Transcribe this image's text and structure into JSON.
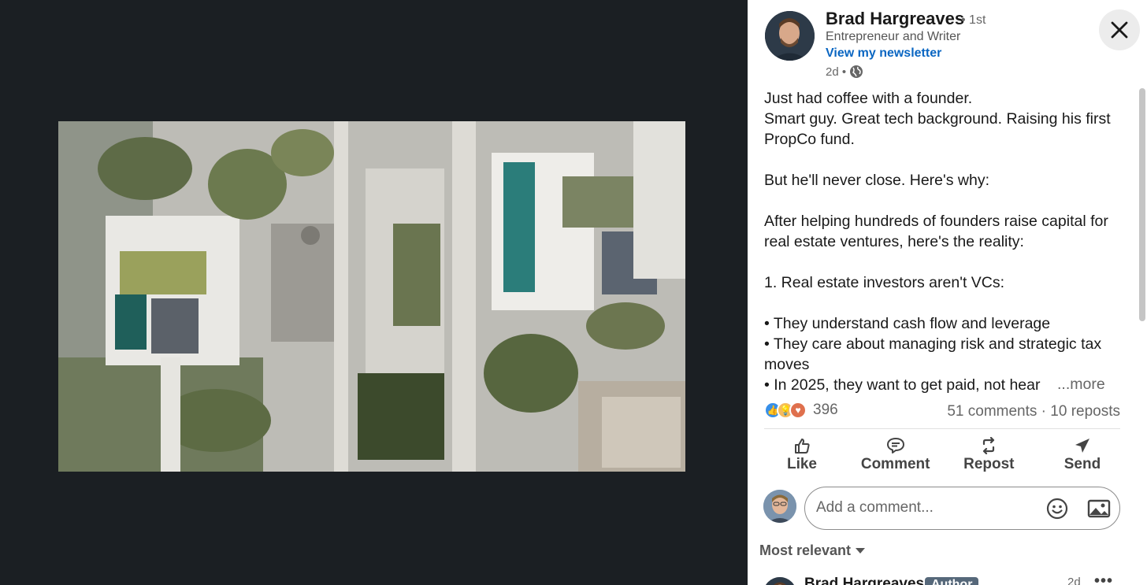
{
  "author": {
    "name": "Brad Hargreaves",
    "degree": "• 1st",
    "headline": "Entrepreneur and Writer",
    "newsletter_link": "View my newsletter",
    "time": "2d •"
  },
  "post": {
    "lines": [
      "Just had coffee with a founder.",
      "Smart guy. Great tech background. Raising his first PropCo fund.",
      "",
      "But he'll never close. Here's why:",
      "",
      "After helping hundreds of founders raise capital for real estate ventures, here's the reality:",
      "",
      "1. Real estate investors aren't VCs:",
      "",
      "• They understand cash flow and leverage",
      "• They care about managing risk and strategic tax moves",
      "• In 2025, they want to get paid, not hear"
    ],
    "more_label": "...more"
  },
  "social": {
    "reaction_count": "396",
    "stats": "51 comments · 10 reposts"
  },
  "actions": {
    "like": "Like",
    "comment": "Comment",
    "repost": "Repost",
    "send": "Send"
  },
  "comment_input": {
    "placeholder": "Add a comment..."
  },
  "sort": {
    "label": "Most relevant"
  },
  "first_comment": {
    "author": "Brad Hargreaves",
    "badge": "Author",
    "time": "2d",
    "more": "•••"
  },
  "icons": {
    "close": "close-icon",
    "globe": "globe-icon",
    "like": "thumbs-up-icon",
    "comment": "comment-icon",
    "repost": "repost-icon",
    "send": "send-icon",
    "emoji": "emoji-icon",
    "image": "image-icon",
    "sort": "caret-down-icon"
  },
  "colors": {
    "background_dark": "#1b1f23",
    "link_blue": "#0a66c2",
    "text_primary": "#191919",
    "text_secondary": "#666666"
  }
}
